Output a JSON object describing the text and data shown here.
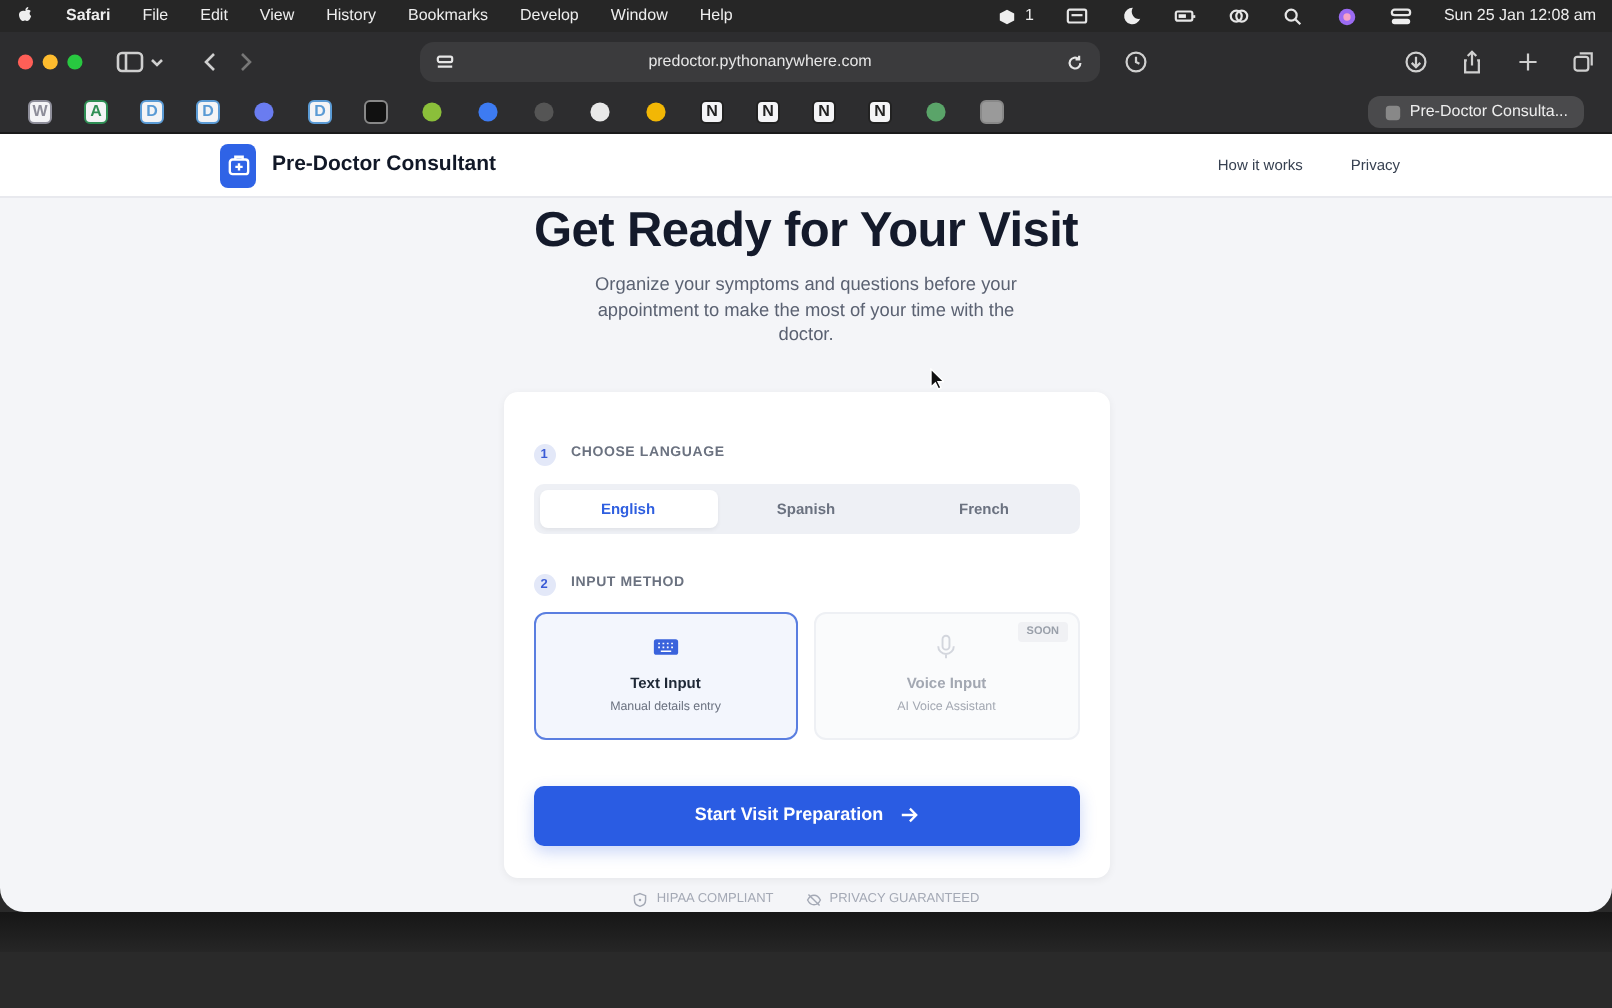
{
  "menu_bar": {
    "app": "Safari",
    "menus": [
      "File",
      "Edit",
      "View",
      "History",
      "Bookmarks",
      "Develop",
      "Window",
      "Help"
    ],
    "badge_count": "1",
    "clock": "Sun 25 Jan  12:08 am"
  },
  "browser": {
    "url": "predoctor.pythonanywhere.com",
    "bookmarks": [
      {
        "kind": "letter",
        "text": "W",
        "color": "#8e8e9a"
      },
      {
        "kind": "letter",
        "text": "A",
        "color": "#2f8f55"
      },
      {
        "kind": "letter",
        "text": "D",
        "color": "#5b9bd5"
      },
      {
        "kind": "letter",
        "text": "D",
        "color": "#5b9bd5"
      },
      {
        "kind": "dot",
        "color": "#6a7cf0"
      },
      {
        "kind": "letter",
        "text": "D",
        "color": "#5b9bd5"
      },
      {
        "kind": "square",
        "color": "#111111"
      },
      {
        "kind": "dot",
        "color": "#8bbf3a"
      },
      {
        "kind": "dot",
        "color": "#3d7bf2"
      },
      {
        "kind": "dot",
        "color": "#555555"
      },
      {
        "kind": "dot",
        "color": "#e8e8e8"
      },
      {
        "kind": "dot",
        "color": "#f2b705"
      },
      {
        "kind": "letter",
        "text": "N",
        "color": "#222222"
      },
      {
        "kind": "letter",
        "text": "N",
        "color": "#222222"
      },
      {
        "kind": "letter",
        "text": "N",
        "color": "#222222"
      },
      {
        "kind": "letter",
        "text": "N",
        "color": "#222222"
      },
      {
        "kind": "dot",
        "color": "#5aa469"
      },
      {
        "kind": "square",
        "color": "#9a9a9a"
      }
    ],
    "tab": {
      "title": "Pre-Doctor Consulta..."
    }
  },
  "page": {
    "brand": "Pre-Doctor Consultant",
    "nav_links": [
      "How it works",
      "Privacy"
    ],
    "heading": "Get Ready for Your Visit",
    "subheading": "Organize your symptoms and questions before your appointment to make the most of your time with the doctor.",
    "steps": [
      {
        "number": "1",
        "label": "CHOOSE LANGUAGE"
      },
      {
        "number": "2",
        "label": "INPUT METHOD"
      }
    ],
    "languages": [
      {
        "label": "English",
        "selected": true
      },
      {
        "label": "Spanish",
        "selected": false
      },
      {
        "label": "French",
        "selected": false
      }
    ],
    "input_methods": [
      {
        "kind": "keyboard",
        "title": "Text Input",
        "subtitle": "Manual details entry",
        "selected": true,
        "disabled": false
      },
      {
        "kind": "microphone",
        "title": "Voice Input",
        "subtitle": "AI Voice Assistant",
        "selected": false,
        "disabled": true,
        "badge": "SOON"
      }
    ],
    "start_button": "Start Visit Preparation",
    "footer_badges": [
      {
        "kind": "shield",
        "label": "HIPAA COMPLIANT"
      },
      {
        "kind": "eye-off",
        "label": "PRIVACY GUARANTEED"
      }
    ]
  }
}
